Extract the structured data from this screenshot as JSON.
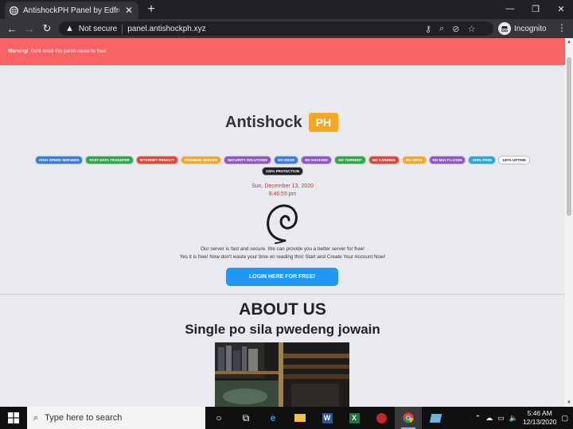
{
  "browser": {
    "tab_title": "AntishockPH Panel by Edfrell",
    "tab_close": "✕",
    "new_tab": "+",
    "security_label": "Not secure",
    "url": "panel.antishockph.xyz",
    "incognito_label": "Incognito"
  },
  "alert": {
    "strong": "Warning!",
    "text": "Dont resell this panel cause its free!"
  },
  "brand": {
    "name": "Antishock",
    "badge": "PH"
  },
  "badges": [
    {
      "label": "HIGH SPEED SERVERS",
      "color": "#3b7dd8"
    },
    {
      "label": "FAST DATA TRANSFER",
      "color": "#2eaa4a"
    },
    {
      "label": "INTERNET PRIVACY",
      "color": "#e0473c"
    },
    {
      "label": "PREMIUM SERVER",
      "color": "#f2a62b"
    },
    {
      "label": "SECURITY SOLUTIONS",
      "color": "#8e56c9"
    },
    {
      "label": "NO DDOS",
      "color": "#3b7dd8"
    },
    {
      "label": "NO HACKING",
      "color": "#8e56c9"
    },
    {
      "label": "NO TORRENT",
      "color": "#2eaa4a"
    },
    {
      "label": "NO CARDING",
      "color": "#e0473c"
    },
    {
      "label": "NO SPAM",
      "color": "#f2a62b"
    },
    {
      "label": "NO MULTI LOGIN",
      "color": "#8e56c9"
    },
    {
      "label": "100% FREE",
      "color": "#29a7d8"
    },
    {
      "label": "100% UPTIME",
      "color": "#ffffff"
    },
    {
      "label": "100% PROTECTION",
      "color": "#222222"
    }
  ],
  "datetime": {
    "date": "Sun, December 13, 2020",
    "time": "9:46:55 pm"
  },
  "description": {
    "line1": "Our server is fast and secure. We can provide you a better server for free!",
    "line2": "Yes it is free! Now don't waste your time on reading this! Start and Create Your Account Now!"
  },
  "login_button": "LOGIN HERE FOR FREE!",
  "about": {
    "heading": "ABOUT US",
    "subheading": "Single po sila pwedeng jowain"
  },
  "taskbar": {
    "search_placeholder": "Type here to search",
    "time": "5:46 AM",
    "date": "12/13/2020"
  }
}
